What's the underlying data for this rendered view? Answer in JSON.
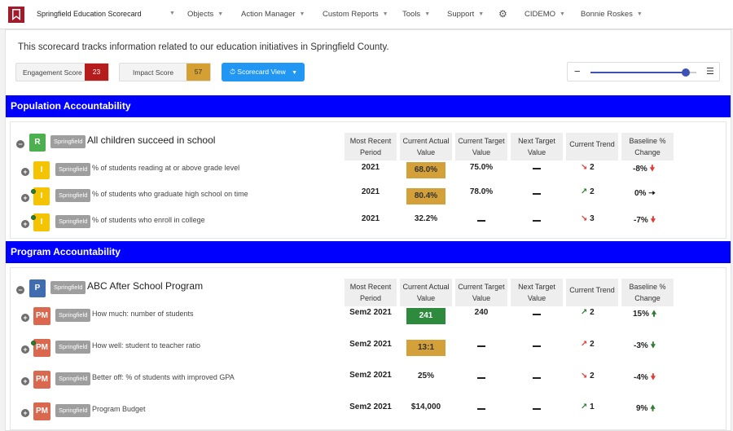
{
  "nav": {
    "title": "Springfield Education Scorecard",
    "items": [
      {
        "label": "Objects"
      },
      {
        "label": "Action Manager"
      },
      {
        "label": "Custom Reports"
      },
      {
        "label": "Tools"
      },
      {
        "label": "Support"
      },
      {
        "label": "CIDEMO"
      },
      {
        "label": "Bonnie Roskes"
      }
    ]
  },
  "description": "This scorecard tracks information related to our education initiatives in Springfield County.",
  "scores": {
    "engagement": {
      "label": "Engagement Score",
      "value": "23",
      "color": "#b71c1c"
    },
    "impact": {
      "label": "Impact Score",
      "value": "57",
      "color": "#d4a033"
    }
  },
  "view_button": "Scorecard View",
  "zoom": {
    "level": 0.9
  },
  "columns": [
    "Most Recent Period",
    "Current Actual Value",
    "Current Target Value",
    "Next Target Value",
    "Current Trend",
    "Baseline % Change"
  ],
  "sections": [
    {
      "title": "Population Accountability",
      "header": {
        "badge": "R",
        "badge_color": "#4caf50",
        "tag": "Springfield",
        "title": "All children succeed in school"
      },
      "rows": [
        {
          "badge": "I",
          "tag": "Springfield",
          "title": "% of students reading at or above grade level",
          "period": "2021",
          "actual": "68.0%",
          "target": "75.0%",
          "trend_count": "2",
          "baseline": "-8%"
        },
        {
          "badge": "I",
          "tag": "Springfield",
          "title": "% of students who graduate high school on time",
          "period": "2021",
          "actual": "80.4%",
          "target": "78.0%",
          "trend_count": "2",
          "baseline": "0%"
        },
        {
          "badge": "I",
          "tag": "Springfield",
          "title": "% of students who enroll in college",
          "period": "2021",
          "actual": "32.2%",
          "target": "",
          "trend_count": "3",
          "baseline": "-7%"
        }
      ]
    },
    {
      "title": "Program Accountability",
      "header": {
        "badge": "P",
        "badge_color": "#3f6db0",
        "tag": "Springfield",
        "title": "ABC After School Program"
      },
      "rows": [
        {
          "badge": "PM",
          "tag": "Springfield",
          "title": "How much: number of students",
          "period": "Sem2 2021",
          "actual": "241",
          "target": "240",
          "trend_count": "2",
          "baseline": "15%"
        },
        {
          "badge": "PM",
          "tag": "Springfield",
          "title": "How well: student to teacher ratio",
          "period": "Sem2 2021",
          "actual": "13:1",
          "target": "",
          "trend_count": "2",
          "baseline": "-3%"
        },
        {
          "badge": "PM",
          "tag": "Springfield",
          "title": "Better off: % of students with improved GPA",
          "period": "Sem2 2021",
          "actual": "25%",
          "target": "",
          "trend_count": "2",
          "baseline": "-4%"
        },
        {
          "badge": "PM",
          "tag": "Springfield",
          "title": "Program Budget",
          "period": "Sem2 2021",
          "actual": "$14,000",
          "target": "",
          "trend_count": "1",
          "baseline": "9%"
        }
      ]
    }
  ]
}
